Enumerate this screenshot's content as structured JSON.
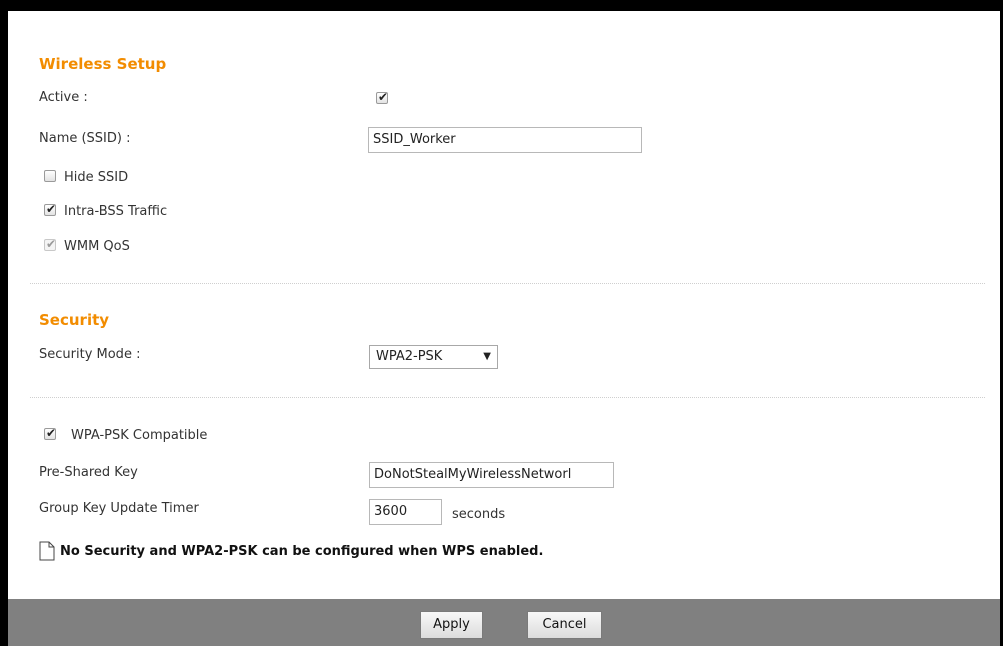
{
  "wireless_setup": {
    "title": "Wireless Setup",
    "active_label": "Active :",
    "active_checked": true,
    "ssid_label": "Name (SSID) :",
    "ssid_value": "SSID_Worker",
    "hide_ssid_label": "Hide SSID",
    "hide_ssid_checked": false,
    "intra_bss_label": "Intra-BSS Traffic",
    "intra_bss_checked": true,
    "wmm_qos_label": "WMM QoS",
    "wmm_qos_checked": true
  },
  "security": {
    "title": "Security",
    "mode_label": "Security Mode :",
    "mode_value": "WPA2-PSK",
    "wpa_psk_compat_label": "WPA-PSK Compatible",
    "wpa_psk_compat_checked": true,
    "psk_label": "Pre-Shared Key",
    "psk_value": "DoNotStealMyWirelessNetworl",
    "group_key_label": "Group Key Update Timer",
    "group_key_value": "3600",
    "group_key_unit": "seconds",
    "note": "No Security and WPA2-PSK can be configured when WPS enabled."
  },
  "footer": {
    "apply_label": "Apply",
    "cancel_label": "Cancel"
  }
}
